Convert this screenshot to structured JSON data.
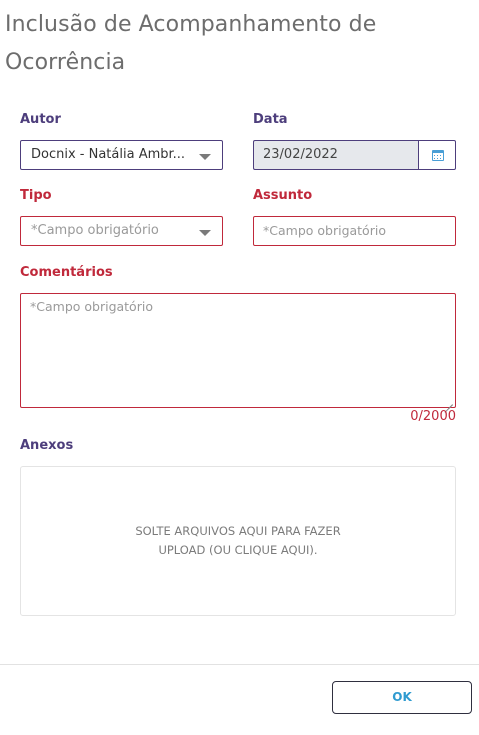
{
  "dialog": {
    "title": "Inclusão de Acompanhamento de Ocorrência"
  },
  "form": {
    "autor": {
      "label": "Autor",
      "value": "Docnix - Natália Ambr..."
    },
    "data": {
      "label": "Data",
      "value": "23/02/2022",
      "icon": "calendar-icon"
    },
    "tipo": {
      "label": "Tipo",
      "placeholder": "*Campo obrigatório"
    },
    "assunto": {
      "label": "Assunto",
      "placeholder": "*Campo obrigatório"
    },
    "comentarios": {
      "label": "Comentários",
      "placeholder": "*Campo obrigatório",
      "counter": "0/2000"
    },
    "anexos": {
      "label": "Anexos",
      "dropzone_text": "SOLTE ARQUIVOS AQUI PARA FAZER UPLOAD (OU CLIQUE AQUI)."
    }
  },
  "footer": {
    "ok_label": "OK"
  },
  "colors": {
    "label_primary": "#4d3e7c",
    "label_error": "#c0293b",
    "accent": "#2f9bd0"
  }
}
